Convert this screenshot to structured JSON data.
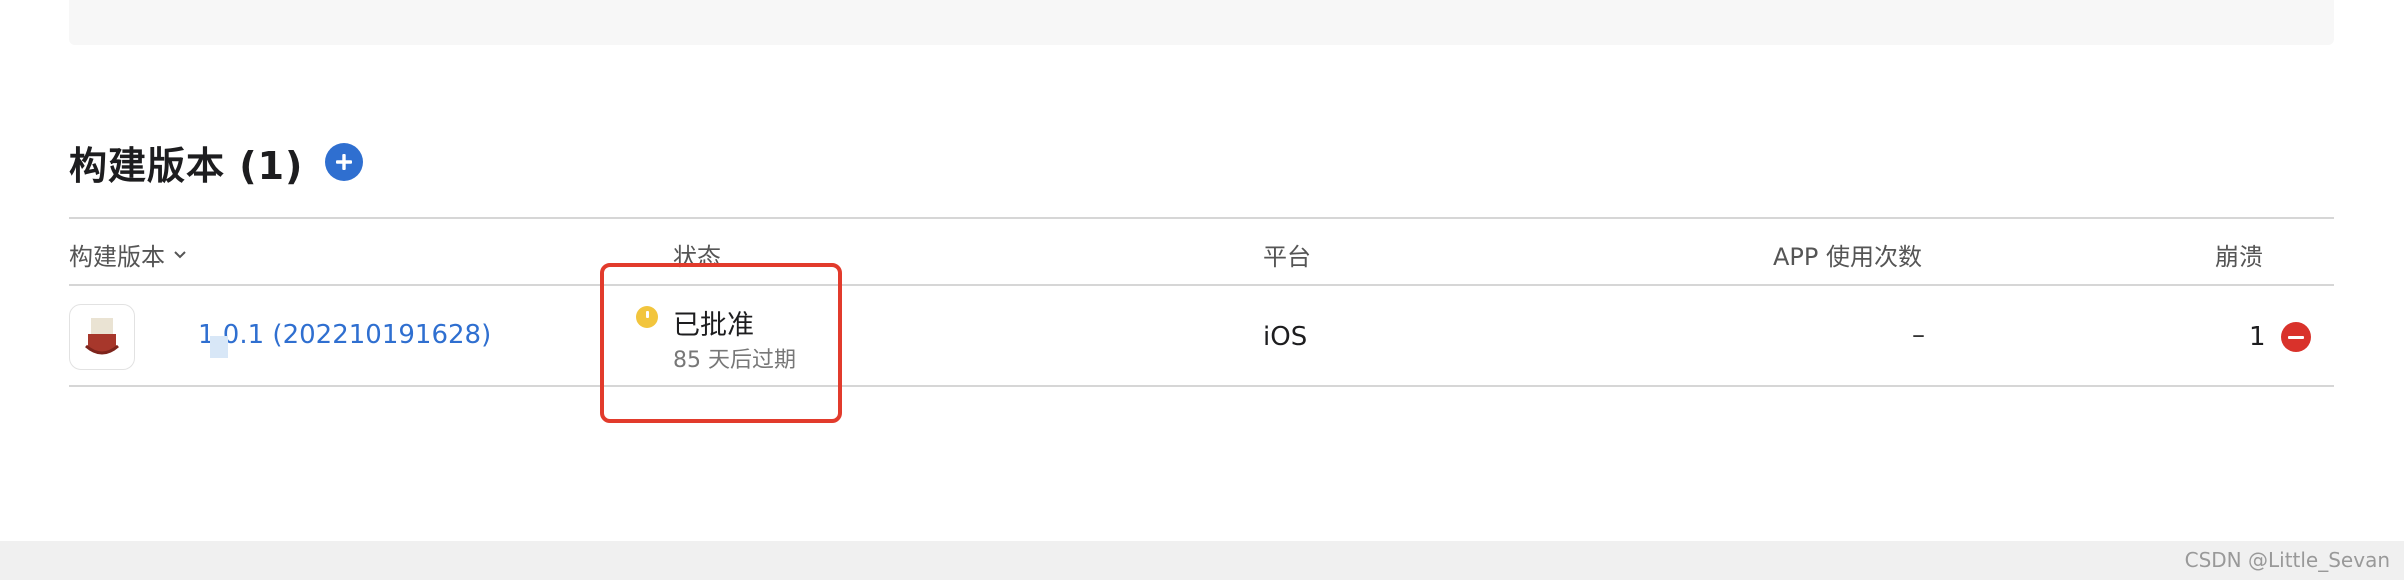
{
  "section": {
    "title": "构建版本 (1)",
    "add_icon": "plus-icon"
  },
  "table": {
    "columns": {
      "build": "构建版本",
      "status": "状态",
      "platform": "平台",
      "usage": "APP 使用次数",
      "crashes": "崩溃"
    },
    "sort_icon": "chevron-down-icon",
    "rows": [
      {
        "thumbnail_icon": "app-icon",
        "build": "1.0.1 (202210191628)",
        "status": "已批准",
        "status_sub": "85 天后过期",
        "status_icon": "clock-icon",
        "status_color": "#f2c53d",
        "platform": "iOS",
        "usage": "–",
        "crashes": "1",
        "crash_icon": "minus-circle-icon"
      }
    ]
  },
  "colors": {
    "accent": "#2f6fd0",
    "highlight": "#e23b2c",
    "crash": "#d9322b"
  },
  "watermark": "CSDN @Little_Sevan"
}
